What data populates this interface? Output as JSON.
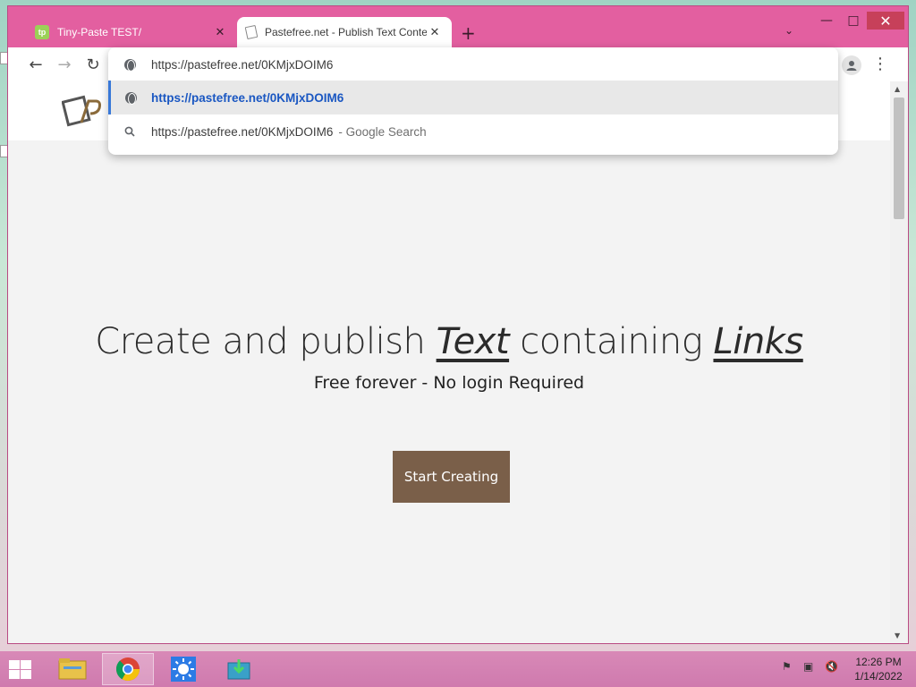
{
  "browser": {
    "tabs": [
      {
        "title": "Tiny-Paste TEST/",
        "favicon": "tp",
        "active": false
      },
      {
        "title": "Pastefree.net - Publish Text Conte",
        "active": true
      }
    ],
    "newtab_label": "+",
    "omnibox": {
      "input_value": "https://pastefree.net/0KMjxDOIM6",
      "suggestions": [
        {
          "text": "https://pastefree.net/0KMjxDOIM6",
          "suffix": "",
          "icon": "globe-icon"
        },
        {
          "text": "https://pastefree.net/0KMjxDOIM6",
          "suffix": "- Google Search",
          "icon": "search-icon"
        }
      ]
    }
  },
  "page": {
    "hero": {
      "title_part1": "Create and publish ",
      "title_em1": "Text",
      "title_part2": " containing ",
      "title_em2": "Links",
      "subtitle": "Free forever - No login Required",
      "cta_label": "Start Creating"
    }
  },
  "taskbar": {
    "time": "12:26 PM",
    "date": "1/14/2022"
  },
  "colors": {
    "window_frame": "#e35fa0",
    "cta": "#7a5f49",
    "link_blue": "#1a57c2"
  }
}
